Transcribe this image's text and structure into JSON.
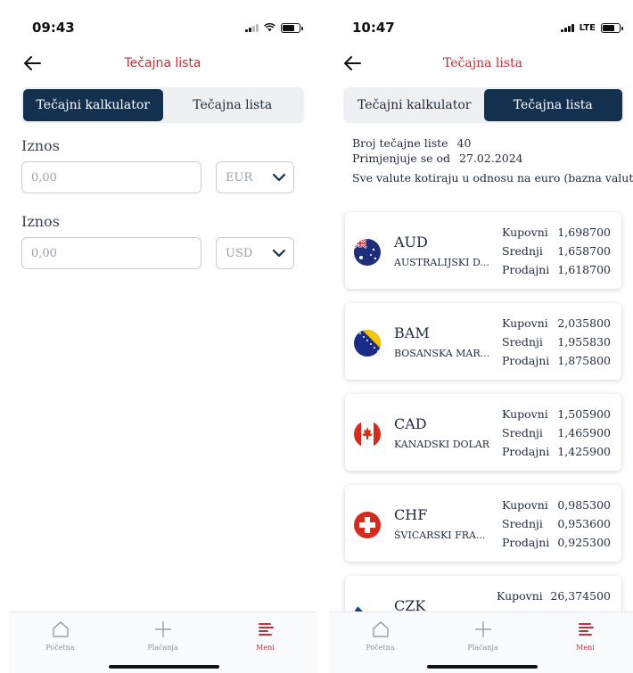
{
  "left": {
    "status": {
      "time": "09:43"
    },
    "header": {
      "title": "Tečajna lista"
    },
    "tabs": [
      {
        "label": "Tečajni kalkulator"
      },
      {
        "label": "Tečajna lista"
      }
    ],
    "fields": [
      {
        "label": "Iznos",
        "placeholder": "0,00",
        "currency": "EUR"
      },
      {
        "label": "Iznos",
        "placeholder": "0,00",
        "currency": "USD"
      }
    ],
    "nav": [
      {
        "label": "Početna"
      },
      {
        "label": "Plaćanja"
      },
      {
        "label": "Meni"
      }
    ]
  },
  "right": {
    "status": {
      "time": "10:47",
      "network": "LTE"
    },
    "header": {
      "title": "Tečajna lista"
    },
    "tabs": [
      {
        "label": "Tečajni kalkulator"
      },
      {
        "label": "Tečajna lista"
      }
    ],
    "info": {
      "list_label": "Broj tečajne liste",
      "list_value": "40",
      "date_label": "Primjenjuje se od",
      "date_value": "27.02.2024",
      "note": "Sve valute kotiraju u odnosu na euro (bazna valuta)"
    },
    "currencies": [
      {
        "code": "AUD",
        "name": "AUSTRALIJSKI D...",
        "buy_label": "Kupovni",
        "buy": "1,698700",
        "mid_label": "Srednji",
        "mid": "1,658700",
        "sell_label": "Prodajni",
        "sell": "1,618700"
      },
      {
        "code": "BAM",
        "name": "BOSANSKA MAR...",
        "buy_label": "Kupovni",
        "buy": "2,035800",
        "mid_label": "Srednji",
        "mid": "1,955830",
        "sell_label": "Prodajni",
        "sell": "1,875800"
      },
      {
        "code": "CAD",
        "name": "KANADSKI DOLAR",
        "buy_label": "Kupovni",
        "buy": "1,505900",
        "mid_label": "Srednji",
        "mid": "1,465900",
        "sell_label": "Prodajni",
        "sell": "1,425900"
      },
      {
        "code": "CHF",
        "name": "ŠVICARSKI FRA...",
        "buy_label": "Kupovni",
        "buy": "0,985300",
        "mid_label": "Srednji",
        "mid": "0,953600",
        "sell_label": "Prodajni",
        "sell": "0,925300"
      },
      {
        "code": "CZK",
        "name": "",
        "buy_label": "Kupovni",
        "buy": "26,374500"
      }
    ],
    "nav": [
      {
        "label": "Početna"
      },
      {
        "label": "Plaćanja"
      },
      {
        "label": "Meni"
      }
    ]
  },
  "colors": {
    "accent": "#c0303a",
    "navy": "#14304f",
    "segment_bg": "#eef0f3",
    "border": "#c9cdd3"
  }
}
